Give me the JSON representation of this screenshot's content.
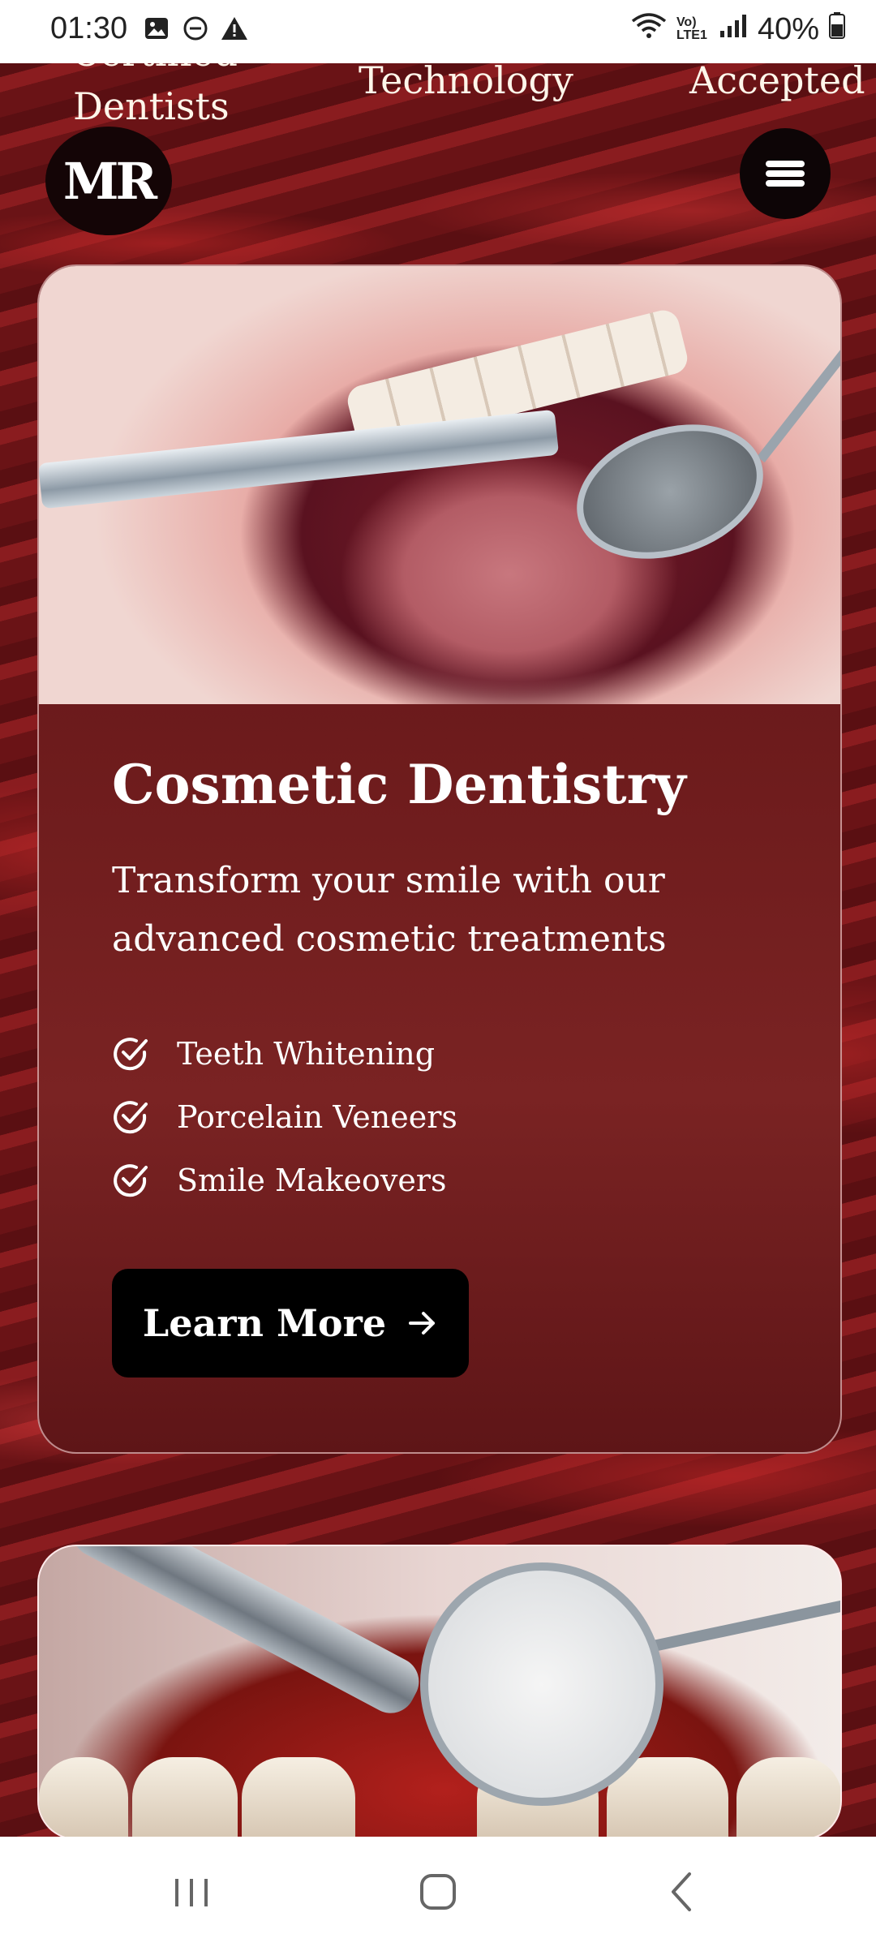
{
  "status_bar": {
    "time": "01:30",
    "battery": "40%",
    "network": "Vo) LTE1"
  },
  "top_strip": {
    "items": [
      "Certified",
      "Dentists",
      "Technology",
      "Accepted"
    ]
  },
  "logo": {
    "text": "MR"
  },
  "card1": {
    "title": "Cosmetic Dentistry",
    "description": "Transform your smile with our advanced cosmetic treatments",
    "features": [
      "Teeth Whitening",
      "Porcelain Veneers",
      "Smile Makeovers"
    ],
    "button_label": "Learn More"
  },
  "colors": {
    "background": "#6e1518",
    "card": "#6d1b1c",
    "button": "#000000",
    "text": "#ffffff"
  },
  "icons": [
    "image-icon",
    "dnd-icon",
    "alert-icon",
    "wifi-icon",
    "signal-icon",
    "battery-icon",
    "menu-icon",
    "check-circle-icon",
    "arrow-right-icon",
    "recents-icon",
    "home-icon",
    "back-icon"
  ]
}
